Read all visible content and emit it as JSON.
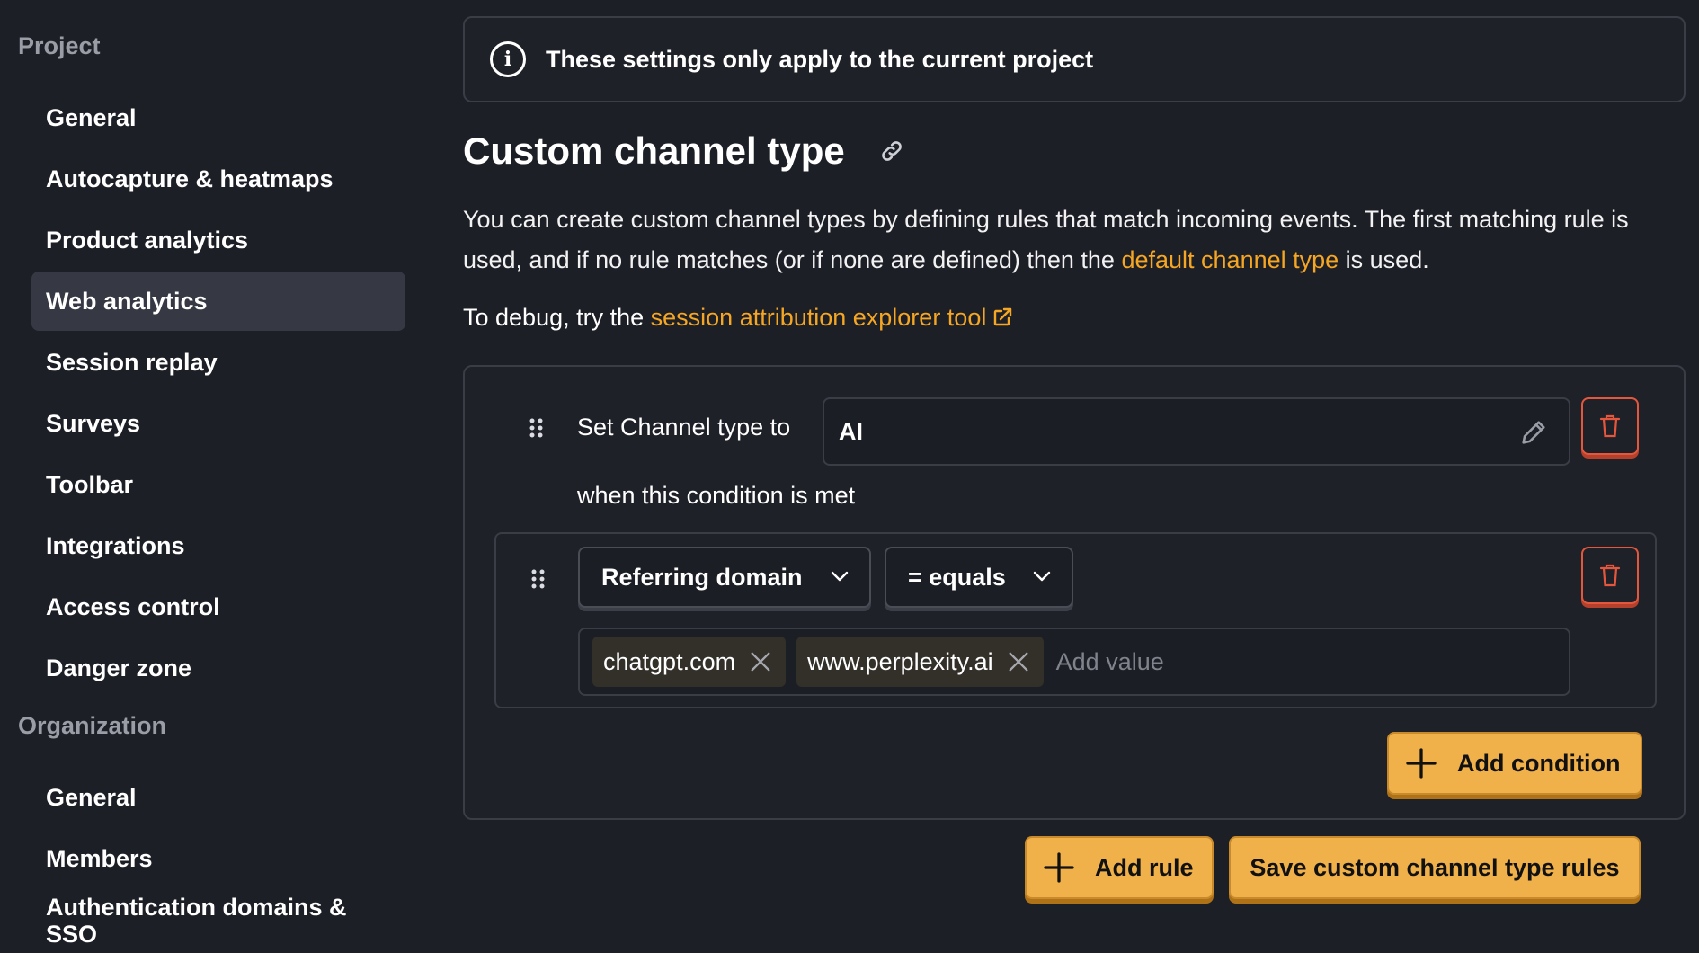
{
  "sidebar": {
    "project_title": "Project",
    "project_items": [
      {
        "label": "General"
      },
      {
        "label": "Autocapture & heatmaps"
      },
      {
        "label": "Product analytics"
      },
      {
        "label": "Web analytics"
      },
      {
        "label": "Session replay"
      },
      {
        "label": "Surveys"
      },
      {
        "label": "Toolbar"
      },
      {
        "label": "Integrations"
      },
      {
        "label": "Access control"
      },
      {
        "label": "Danger zone"
      }
    ],
    "active_item": "Web analytics",
    "organization_title": "Organization",
    "organization_items": [
      {
        "label": "General"
      },
      {
        "label": "Members"
      },
      {
        "label": "Authentication domains & SSO"
      }
    ]
  },
  "banner": {
    "text": "These settings only apply to the current project",
    "icon": "info-icon"
  },
  "page": {
    "title": "Custom channel type",
    "description_part1": "You can create custom channel types by defining rules that match incoming events. The first matching rule is used, and if no rule matches (or if none are defined) then the ",
    "description_link": "default channel type",
    "description_part2": " is used.",
    "debug_prefix": "To debug, try the ",
    "debug_link": "session attribution explorer tool"
  },
  "rule": {
    "set_label": "Set Channel type to",
    "channel_value": "AI",
    "when_label": "when this condition is met",
    "condition": {
      "property": "Referring domain",
      "operator": "= equals",
      "values": [
        "chatgpt.com",
        "www.perplexity.ai"
      ],
      "add_value_placeholder": "Add value"
    },
    "add_condition_label": "Add condition"
  },
  "actions": {
    "add_rule_label": "Add rule",
    "save_label": "Save custom channel type rules"
  },
  "colors": {
    "background": "#1d1f27",
    "accent": "#f5a623",
    "button": "#f0b04a",
    "danger": "#e4573d"
  }
}
